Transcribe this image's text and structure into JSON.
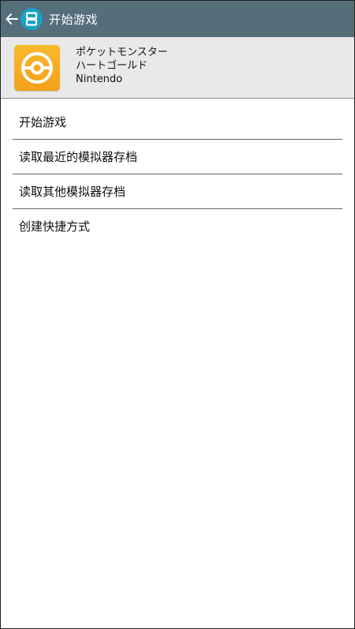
{
  "action_bar": {
    "title": "开始游戏",
    "back_icon": "arrow-left-icon",
    "app_icon": "ds-emulator-icon",
    "color": "#546e7a",
    "app_icon_color": "#17a2c6"
  },
  "game": {
    "title_line1": "ポケットモンスター",
    "title_line2": "ハートゴールド",
    "publisher": "Nintendo",
    "icon": "pokeball-icon",
    "icon_color": "#f6a81f"
  },
  "menu": {
    "items": [
      {
        "label": "开始游戏"
      },
      {
        "label": "读取最近的模拟器存档"
      },
      {
        "label": "读取其他模拟器存档"
      },
      {
        "label": "创建快捷方式"
      }
    ]
  }
}
